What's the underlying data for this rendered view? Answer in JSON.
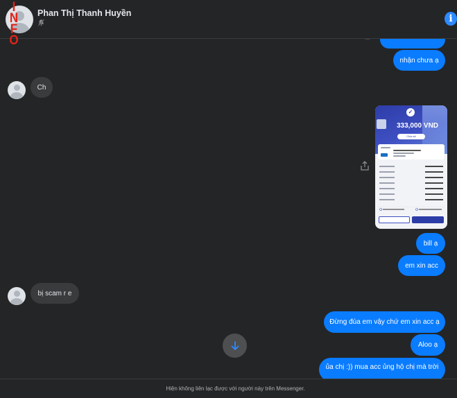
{
  "header": {
    "contact_name": "Phan Thị Thanh Huyền",
    "watermark": [
      "I",
      "N",
      "F",
      "O"
    ],
    "mute_icon": "bell-off-icon",
    "info_icon": "info-icon",
    "info_glyph": "i"
  },
  "messages": [
    {
      "direction": "out",
      "text": "nhận chưa ạ"
    },
    {
      "direction": "in",
      "text": "Ch"
    },
    {
      "direction": "out",
      "type": "image",
      "image": {
        "amount": "333,000 VND",
        "share_label": "Chia sẻ"
      }
    },
    {
      "direction": "out",
      "text": "bill ạ"
    },
    {
      "direction": "out",
      "text": "em xin acc"
    },
    {
      "direction": "in",
      "text": "bị scam r e"
    },
    {
      "direction": "out",
      "text": "Đừng đùa em vậy chứ em xin acc ạ"
    },
    {
      "direction": "out",
      "text": "Aloo ạ"
    },
    {
      "direction": "out",
      "text": "ủa chị :)) mua acc ủng hộ chị mà trời"
    }
  ],
  "footer": {
    "notice": "Hiện không liên lạc được với người này trên Messenger."
  },
  "colors": {
    "background": "#242526",
    "outgoing_bubble": "#0a7cff",
    "incoming_bubble": "#3a3b3c",
    "accent": "#2e89ff"
  }
}
